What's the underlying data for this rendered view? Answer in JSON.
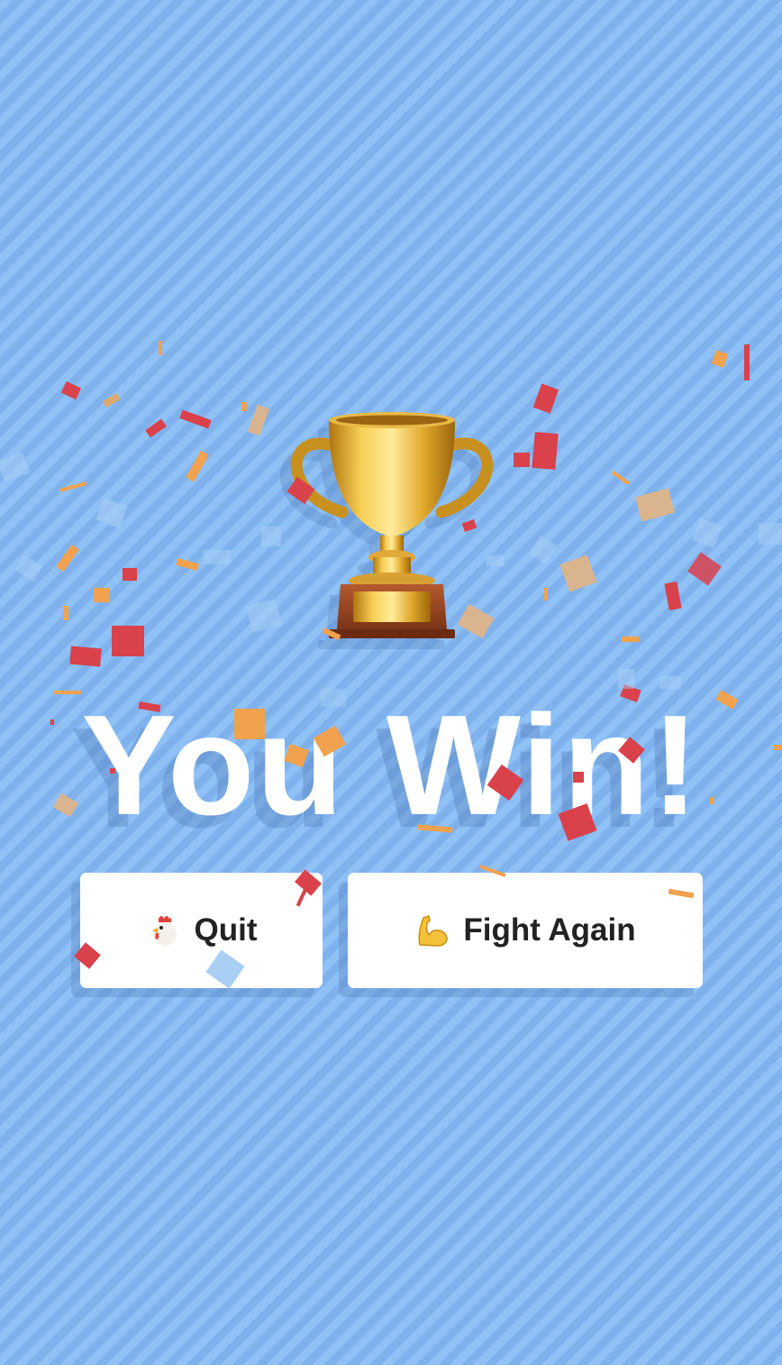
{
  "screen": {
    "title": "You Win!",
    "trophy_icon": "trophy-icon"
  },
  "buttons": {
    "quit": {
      "label": "Quit",
      "icon": "chicken-icon"
    },
    "fight_again": {
      "label": "Fight Again",
      "icon": "flexed-biceps-icon"
    }
  },
  "colors": {
    "background": "#8cbdf4",
    "stripe": "#7fb2ed",
    "button_bg": "#ffffff",
    "button_text": "#222222",
    "title_text": "#ffffff",
    "confetti_red": "#d9414b",
    "confetti_orange": "#f0a24e",
    "confetti_tan": "#d9b48f",
    "confetti_blue": "#a9cff5"
  }
}
